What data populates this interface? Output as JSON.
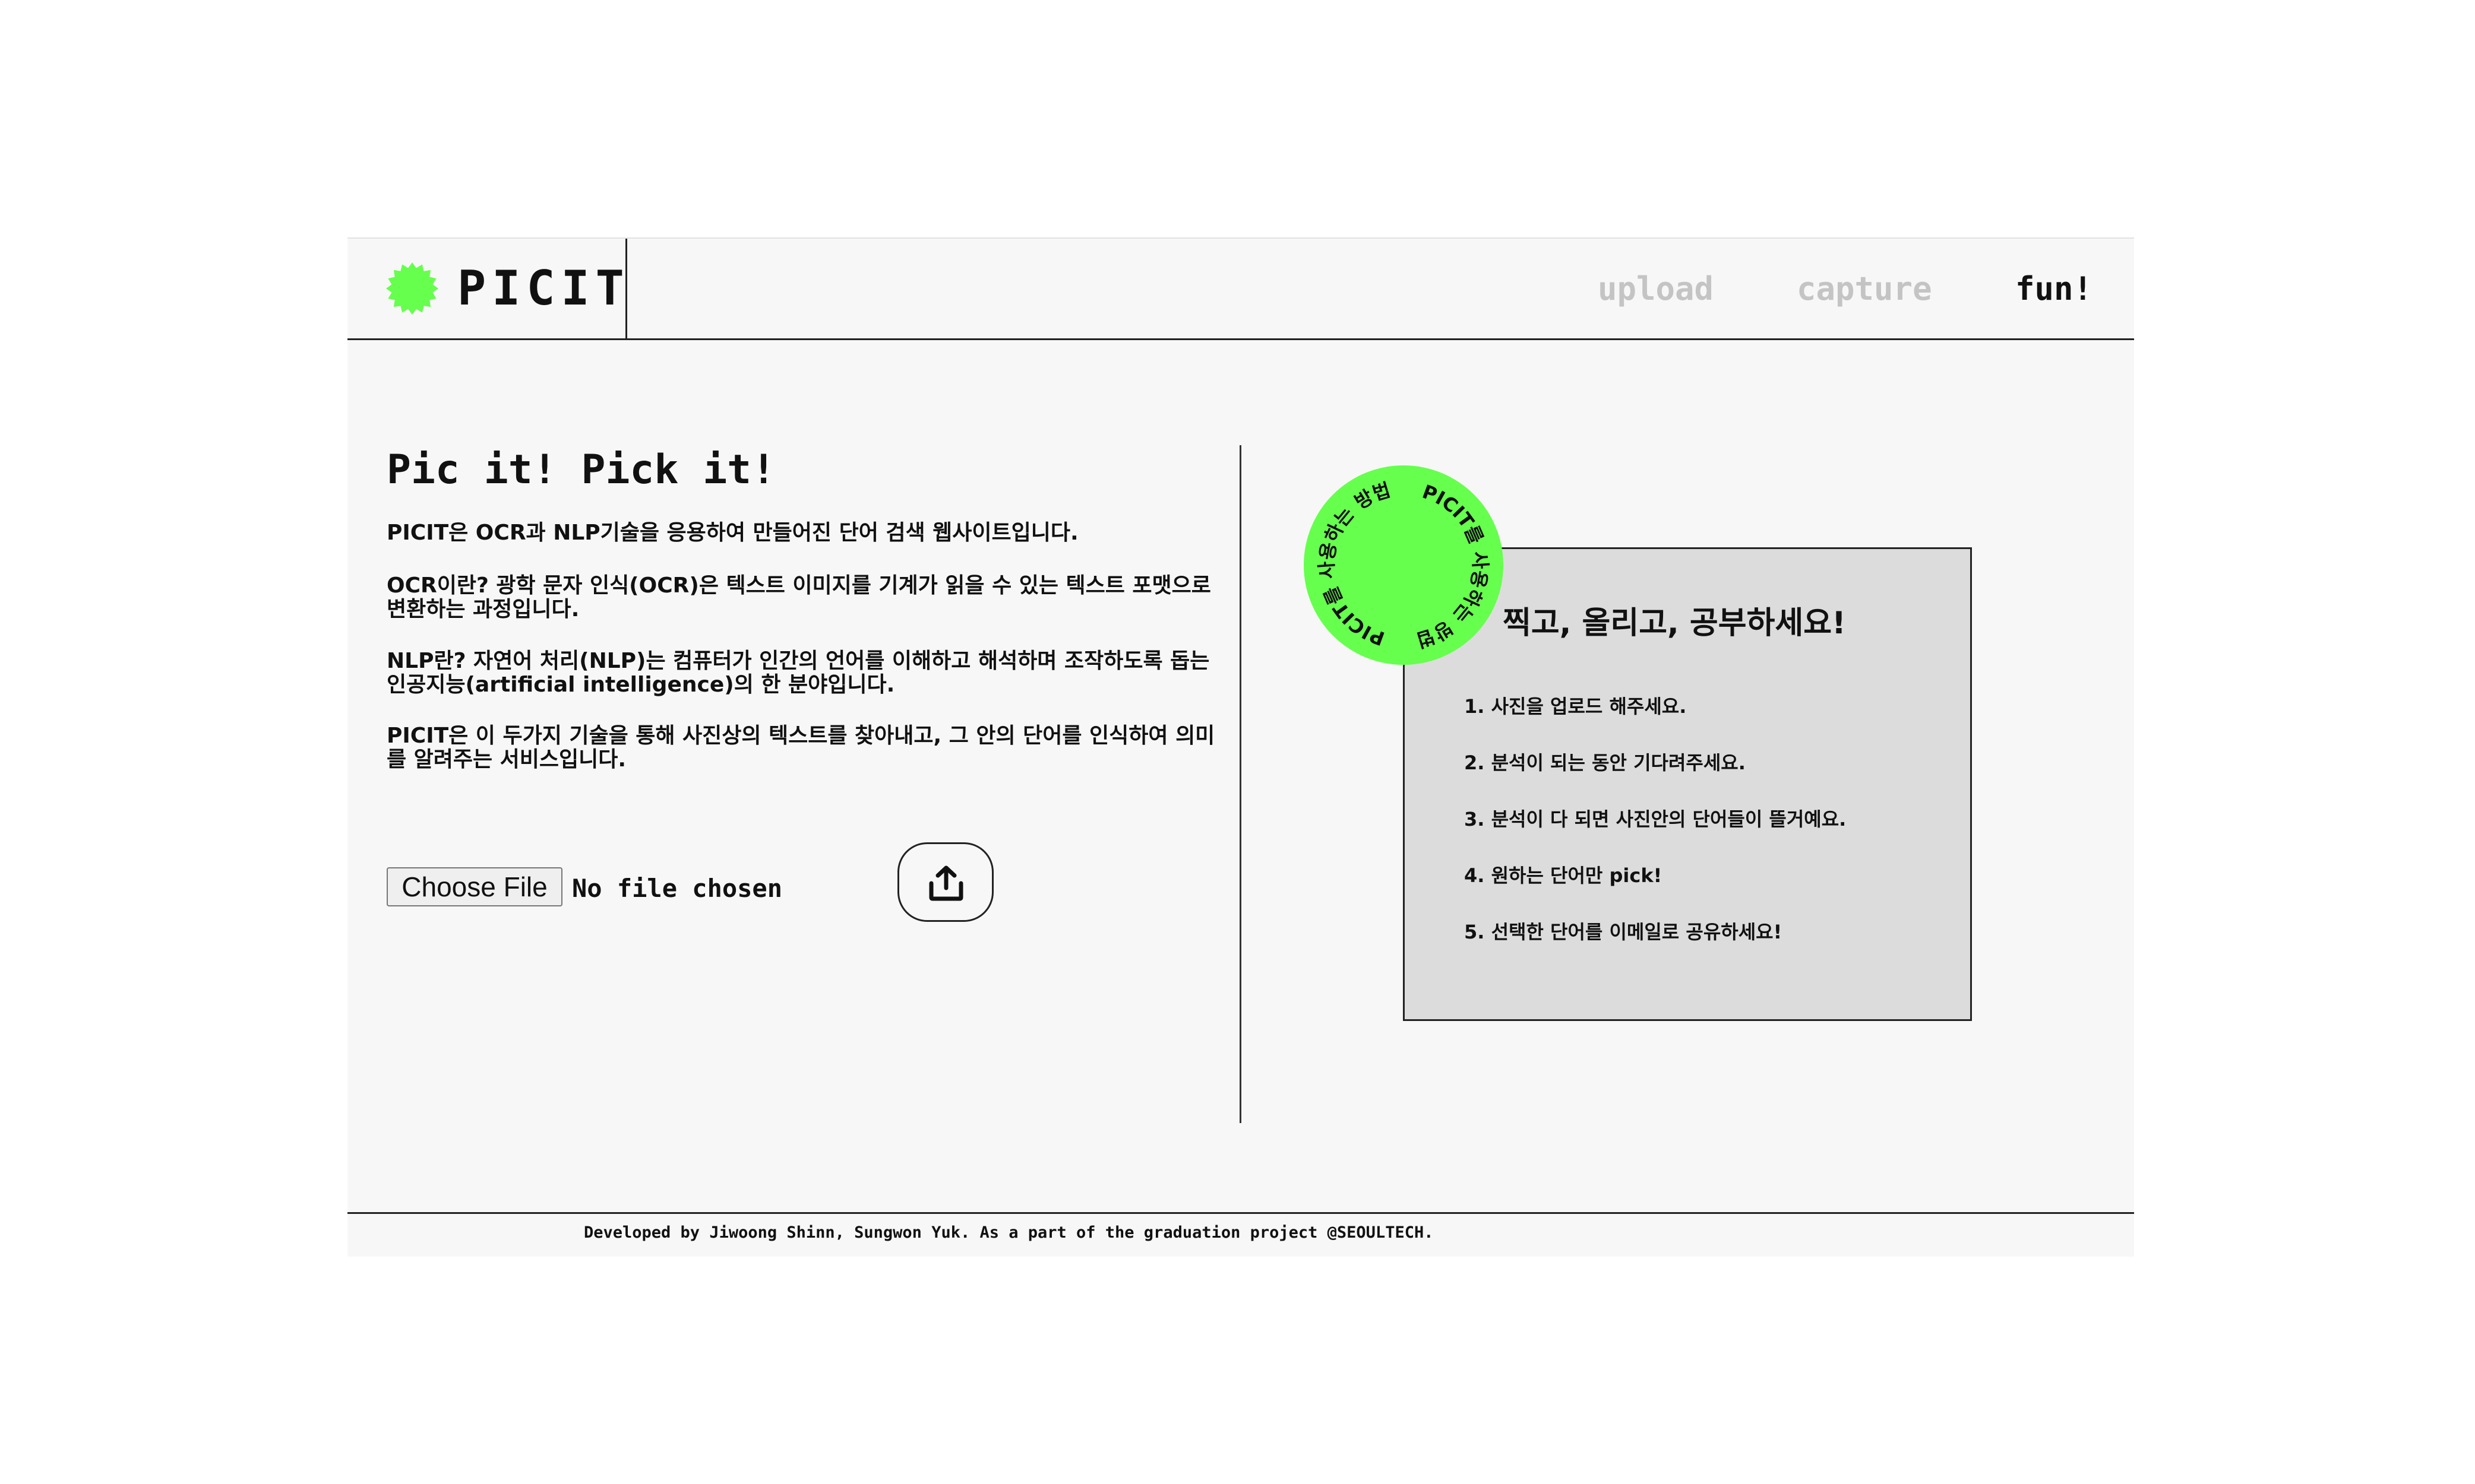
{
  "brand": {
    "name": "PICIT",
    "accent": "#66ff4d"
  },
  "nav": [
    {
      "label": "upload"
    },
    {
      "label": "capture"
    },
    {
      "label": "fun!"
    }
  ],
  "intro": {
    "headline": "Pic it! Pick it!",
    "paragraphs": [
      "PICIT은 OCR과 NLP기술을 응용하여 만들어진 단어 검색 웹사이트입니다.",
      "OCR이란? 광학 문자 인식(OCR)은 텍스트 이미지를 기계가 읽을 수 있는 텍스트 포맷으로 변환하는 과정입니다.",
      "NLP란? 자연어 처리(NLP)는 컴퓨터가 인간의 언어를 이해하고 해석하며 조작하도록 돕는 인공지능(artificial intelligence)의 한 분야입니다.",
      "PICIT은 이 두가지 기술을 통해 사진상의 텍스트를 찾아내고, 그 안의 단어를 인식하여 의미를 알려주는 서비스입니다."
    ]
  },
  "upload": {
    "choose_file_label": "Choose File",
    "status": "No file chosen",
    "button_icon": "upload-icon"
  },
  "guide": {
    "badge_text": "PICIT를 사용하는 방법",
    "title": "찍고, 올리고, 공부하세요!",
    "steps": [
      "1. 사진을 업로드 해주세요.",
      "2. 분석이 되는 동안 기다려주세요.",
      "3. 분석이 다 되면 사진안의 단어들이 뜰거예요.",
      "4. 원하는 단어만 pick!",
      "5. 선택한 단어를 이메일로 공유하세요!"
    ]
  },
  "footer": {
    "text": "Developed by Jiwoong Shinn, Sungwon Yuk. As a part of the graduation project @SEOULTECH."
  }
}
